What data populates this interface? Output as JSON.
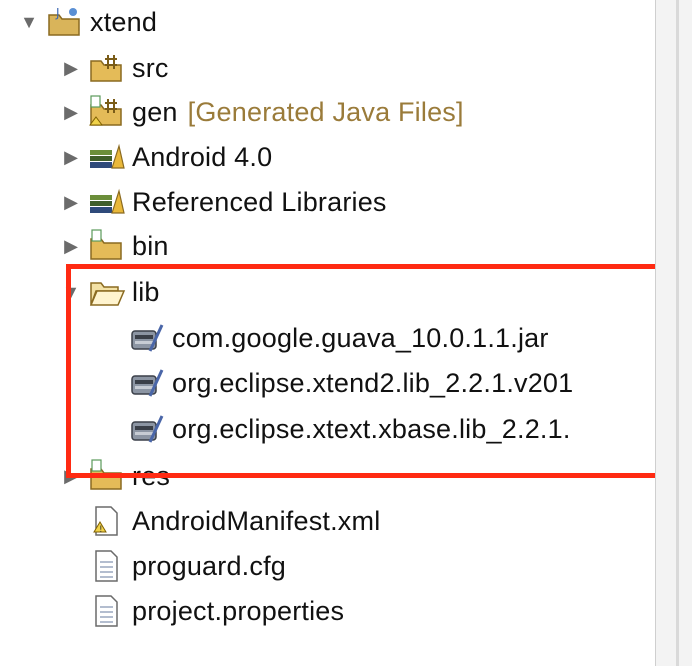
{
  "project_tree": {
    "root": {
      "label": "xtend",
      "icon": "java-project-icon",
      "expanded": true
    },
    "items": [
      {
        "label": "src",
        "icon": "source-folder-icon",
        "expanded": false
      },
      {
        "label": "gen",
        "decoration": "[Generated Java Files]",
        "icon": "generated-folder-icon",
        "expanded": false
      },
      {
        "label": "Android 4.0",
        "icon": "library-container-icon",
        "expanded": false
      },
      {
        "label": "Referenced Libraries",
        "icon": "library-container-icon",
        "expanded": false
      },
      {
        "label": "bin",
        "icon": "folder-icon",
        "expanded": false
      },
      {
        "label": "lib",
        "icon": "open-folder-icon",
        "expanded": true,
        "children": [
          {
            "label": "com.google.guava_10.0.1.1.jar",
            "icon": "jar-icon"
          },
          {
            "label": "org.eclipse.xtend2.lib_2.2.1.v201",
            "icon": "jar-icon"
          },
          {
            "label": "org.eclipse.xtext.xbase.lib_2.2.1.",
            "icon": "jar-icon"
          }
        ]
      },
      {
        "label": "res",
        "icon": "folder-icon",
        "expanded": false
      },
      {
        "label": "AndroidManifest.xml",
        "icon": "xml-file-icon"
      },
      {
        "label": "proguard.cfg",
        "icon": "file-icon"
      },
      {
        "label": "project.properties",
        "icon": "file-icon"
      }
    ]
  },
  "colors": {
    "highlight": "#ff2a12",
    "decoration_text": "#9a7b3a"
  }
}
